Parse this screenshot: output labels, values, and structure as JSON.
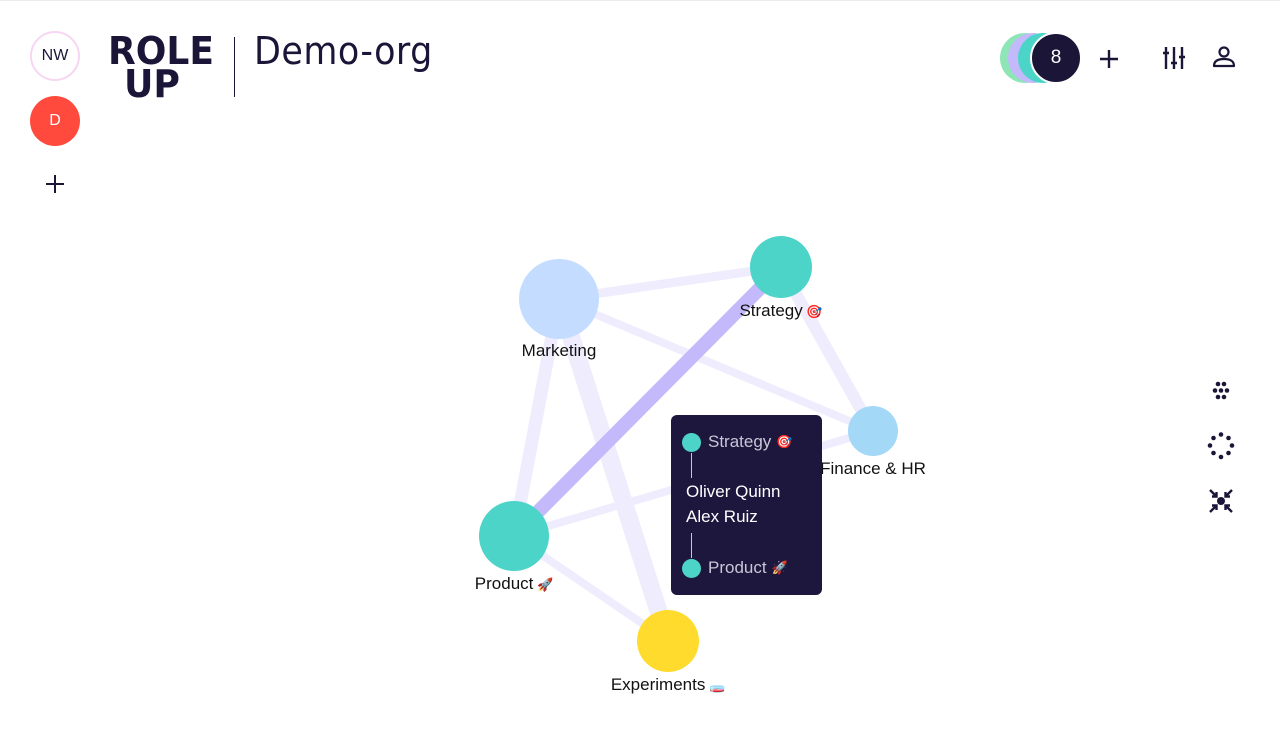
{
  "org_rail": {
    "orgs": [
      {
        "initials": "NW",
        "selected": false
      },
      {
        "initials": "D",
        "selected": true,
        "color": "#ff4a3d"
      }
    ],
    "add_icon": "plus-icon"
  },
  "header": {
    "logo_line1": "ROLE",
    "logo_line2": "UP",
    "org_name": "Demo-org"
  },
  "toolbar": {
    "member_count": "8",
    "member_colors": [
      "#8ee6b7",
      "#c4b9fb",
      "#4dd4c9"
    ],
    "add_icon": "plus-icon",
    "filter_icon": "sliders-icon",
    "profile_icon": "user-icon"
  },
  "side_tools": [
    {
      "icon": "cluster-layout-icon"
    },
    {
      "icon": "circle-layout-icon"
    },
    {
      "icon": "center-collapse-icon"
    }
  ],
  "graph": {
    "nodes": [
      {
        "id": "marketing",
        "label": "Marketing",
        "emoji": "",
        "color": "#c4dcff"
      },
      {
        "id": "strategy",
        "label": "Strategy",
        "emoji": "🎯",
        "color": "#4dd4c9"
      },
      {
        "id": "finance",
        "label": "Finance & HR",
        "emoji": "",
        "color": "#a3d8f7"
      },
      {
        "id": "product",
        "label": "Product",
        "emoji": "🚀",
        "color": "#4dd4c9"
      },
      {
        "id": "experiments",
        "label": "Experiments",
        "emoji": "🧫",
        "color": "#ffdb2e"
      }
    ],
    "edges": [
      {
        "source": "marketing",
        "target": "strategy",
        "highlighted": false
      },
      {
        "source": "marketing",
        "target": "finance",
        "highlighted": false
      },
      {
        "source": "marketing",
        "target": "product",
        "highlighted": false
      },
      {
        "source": "marketing",
        "target": "experiments",
        "highlighted": false
      },
      {
        "source": "strategy",
        "target": "finance",
        "highlighted": false
      },
      {
        "source": "strategy",
        "target": "product",
        "highlighted": true
      },
      {
        "source": "product",
        "target": "finance",
        "highlighted": false
      },
      {
        "source": "product",
        "target": "experiments",
        "highlighted": false
      }
    ],
    "edge_color": "#efedfd",
    "highlight_color": "#c4b9fb"
  },
  "tooltip": {
    "from_team": "Strategy",
    "from_emoji": "🎯",
    "people": [
      "Oliver Quinn",
      "Alex Ruiz"
    ],
    "to_team": "Product",
    "to_emoji": "🚀"
  }
}
